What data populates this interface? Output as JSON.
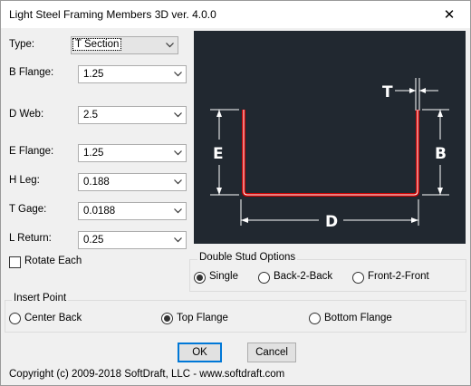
{
  "window": {
    "title": "Light Steel Framing Members 3D ver. 4.0.0",
    "close_glyph": "✕"
  },
  "fields": {
    "type": {
      "label": "Type:",
      "value": "T Section"
    },
    "b_flange": {
      "label": "B Flange:",
      "value": "1.25"
    },
    "d_web": {
      "label": "D Web:",
      "value": "2.5"
    },
    "e_flange": {
      "label": "E Flange:",
      "value": "1.25"
    },
    "h_leg": {
      "label": "H Leg:",
      "value": "0.188"
    },
    "t_gage": {
      "label": "T Gage:",
      "value": "0.0188"
    },
    "l_return": {
      "label": "L Return:",
      "value": "0.25"
    }
  },
  "rotate_each": {
    "label": "Rotate Each",
    "checked": false
  },
  "diagram": {
    "labels": {
      "t": "T",
      "b": "B",
      "e": "E",
      "d": "D"
    },
    "background": "#212830",
    "profile_color": "#cc0000",
    "dimension_color": "#ffffff"
  },
  "double_stud": {
    "title": "Double Stud Options",
    "options": [
      "Single",
      "Back-2-Back",
      "Front-2-Front"
    ],
    "selected": "Single"
  },
  "insert_point": {
    "title": "Insert Point",
    "options": [
      "Center Back",
      "Top Flange",
      "Bottom Flange"
    ],
    "selected": "Top Flange"
  },
  "buttons": {
    "ok": "OK",
    "cancel": "Cancel"
  },
  "copyright": "Copyright (c) 2009-2018 SoftDraft, LLC - www.softdraft.com"
}
